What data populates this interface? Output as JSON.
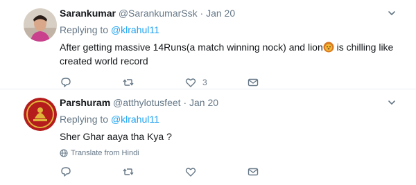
{
  "tweets": [
    {
      "name": "Sarankumar",
      "handle": "@SarankumarSsk",
      "separator": "·",
      "time": "Jan 20",
      "replying_prefix": "Replying to",
      "replying_to": "@klrahul11",
      "text_before": "After getting massive 14Runs(a match winning nock) and lion",
      "emoji": "lion-face",
      "text_after": " is chilling like created world record",
      "reply_count": "",
      "retweet_count": "",
      "like_count": "3",
      "avatar_colors": {
        "bg": "#c9b7a6",
        "accent": "#c9418d"
      }
    },
    {
      "name": "Parshuram",
      "handle": "@atthylotusfeet",
      "separator": "·",
      "time": "Jan 20",
      "replying_prefix": "Replying to",
      "replying_to": "@klrahul11",
      "text": "Sher Ghar aaya tha Kya ?",
      "translate_label": "Translate from Hindi",
      "reply_count": "",
      "retweet_count": "",
      "like_count": "",
      "avatar_colors": {
        "bg": "#b51d1d",
        "accent": "#e0b43a"
      }
    }
  ],
  "colors": {
    "link": "#1da1f2",
    "muted": "#657786",
    "text": "#14171a",
    "border": "#e6ecf0"
  }
}
